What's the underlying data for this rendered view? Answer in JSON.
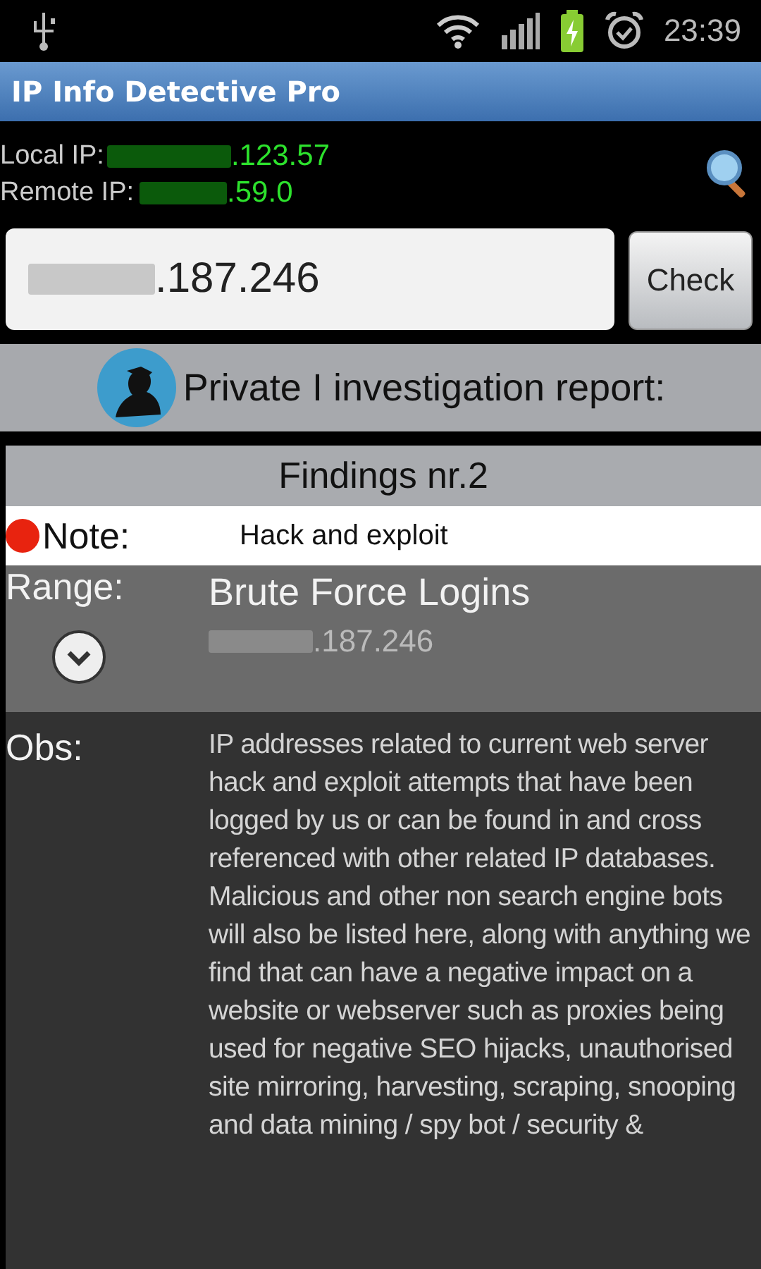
{
  "status_bar": {
    "time": "23:39"
  },
  "title_bar": {
    "title": "IP Info Detective Pro"
  },
  "ip_info": [
    {
      "label": "Local IP:",
      "value": ".123.57"
    },
    {
      "label": "Remote IP:",
      "value": ".59.0"
    }
  ],
  "lookup": {
    "value": ".187.246",
    "button": "Check"
  },
  "report": {
    "title": "Private I investigation report:"
  },
  "findings": {
    "title": "Findings nr.2",
    "note": {
      "label": "Note:",
      "value": "Hack and exploit",
      "color": "#e8230f"
    },
    "range": {
      "label": "Range:",
      "title": "Brute Force Logins",
      "value": ".187.246"
    },
    "obs": {
      "label": "Obs:",
      "text": "IP addresses related to current web server hack and exploit attempts that have been logged by us or can be found in and cross referenced with other related IP databases. Malicious and other non search engine bots will also be listed here, along with anything we find that can have a negative impact on a website or webserver such as proxies being used for negative SEO hijacks, unauthorised site mirroring, harvesting, scraping, snooping and data mining / spy bot / security &"
    }
  }
}
